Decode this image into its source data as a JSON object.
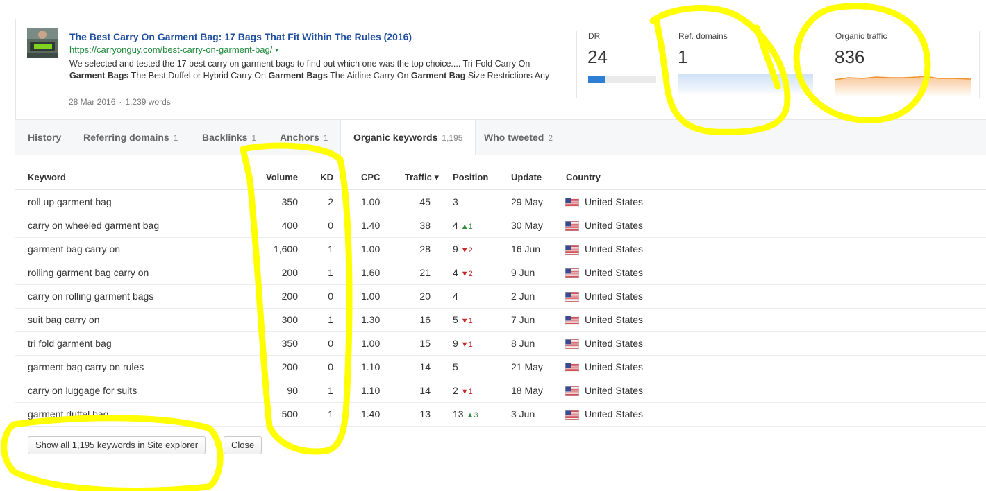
{
  "article": {
    "title": "The Best Carry On Garment Bag: 17 Bags That Fit Within The Rules (2016)",
    "url": "https://carryonguy.com/best-carry-on-garment-bag/",
    "url_caret": "▾",
    "snippet_parts": [
      {
        "text": "We selected and tested the 17 best carry on garment bags to find out which one was the top choice.... Tri-Fold Carry On ",
        "bold": false
      },
      {
        "text": "Garment Bags",
        "bold": true
      },
      {
        "text": " The Best Duffel or Hybrid Carry On ",
        "bold": false
      },
      {
        "text": "Garment Bags",
        "bold": true
      },
      {
        "text": " The Airline Carry On ",
        "bold": false
      },
      {
        "text": "Garment Bag",
        "bold": true
      },
      {
        "text": " Size Restrictions Any",
        "bold": false
      }
    ],
    "date": "28 Mar 2016",
    "separator": "·",
    "words": "1,239 words"
  },
  "metrics": {
    "dr": {
      "label": "DR",
      "value": "24",
      "bar_fraction": 0.24,
      "bar_color": "#2d7fd3"
    },
    "ref_domains": {
      "label": "Ref. domains",
      "value": "1",
      "area_color": "#7eaee5"
    },
    "organic_traffic": {
      "label": "Organic traffic",
      "value": "836",
      "line_color": "#f0902a"
    }
  },
  "tabs": [
    {
      "label": "History",
      "count": ""
    },
    {
      "label": "Referring domains",
      "count": "1"
    },
    {
      "label": "Backlinks",
      "count": "1"
    },
    {
      "label": "Anchors",
      "count": "1"
    },
    {
      "label": "Organic keywords",
      "count": "1,195",
      "active": true
    },
    {
      "label": "Who tweeted",
      "count": "2"
    }
  ],
  "table": {
    "columns": [
      "Keyword",
      "Volume",
      "KD",
      "CPC",
      "Traffic ▾",
      "Position",
      "Update",
      "Country"
    ],
    "rows": [
      {
        "keyword": "roll up garment bag",
        "volume": "350",
        "kd": "2",
        "cpc": "1.00",
        "traffic": "45",
        "position": "3",
        "change": "",
        "dir": "",
        "update": "29 May",
        "country": "United States"
      },
      {
        "keyword": "carry on wheeled garment bag",
        "volume": "400",
        "kd": "0",
        "cpc": "1.40",
        "traffic": "38",
        "position": "4",
        "change": "▲1",
        "dir": "up",
        "update": "30 May",
        "country": "United States"
      },
      {
        "keyword": "garment bag carry on",
        "volume": "1,600",
        "kd": "1",
        "cpc": "1.00",
        "traffic": "28",
        "position": "9",
        "change": "▼2",
        "dir": "down",
        "update": "16 Jun",
        "country": "United States"
      },
      {
        "keyword": "rolling garment bag carry on",
        "volume": "200",
        "kd": "1",
        "cpc": "1.60",
        "traffic": "21",
        "position": "4",
        "change": "▼2",
        "dir": "down",
        "update": "9 Jun",
        "country": "United States"
      },
      {
        "keyword": "carry on rolling garment bags",
        "volume": "200",
        "kd": "0",
        "cpc": "1.00",
        "traffic": "20",
        "position": "4",
        "change": "",
        "dir": "",
        "update": "2 Jun",
        "country": "United States"
      },
      {
        "keyword": "suit bag carry on",
        "volume": "300",
        "kd": "1",
        "cpc": "1.30",
        "traffic": "16",
        "position": "5",
        "change": "▼1",
        "dir": "down",
        "update": "7 Jun",
        "country": "United States"
      },
      {
        "keyword": "tri fold garment bag",
        "volume": "350",
        "kd": "0",
        "cpc": "1.00",
        "traffic": "15",
        "position": "9",
        "change": "▼1",
        "dir": "down",
        "update": "8 Jun",
        "country": "United States"
      },
      {
        "keyword": "garment bag carry on rules",
        "volume": "200",
        "kd": "0",
        "cpc": "1.10",
        "traffic": "14",
        "position": "5",
        "change": "",
        "dir": "",
        "update": "21 May",
        "country": "United States"
      },
      {
        "keyword": "carry on luggage for suits",
        "volume": "90",
        "kd": "1",
        "cpc": "1.10",
        "traffic": "14",
        "position": "2",
        "change": "▼1",
        "dir": "down",
        "update": "18 May",
        "country": "United States"
      },
      {
        "keyword": "garment duffel bag",
        "volume": "500",
        "kd": "1",
        "cpc": "1.40",
        "traffic": "13",
        "position": "13",
        "change": "▲3",
        "dir": "up",
        "update": "3 Jun",
        "country": "United States"
      }
    ]
  },
  "buttons": {
    "show_all": "Show all 1,195 keywords in Site explorer",
    "close": "Close"
  },
  "colors": {
    "highlight": "#ffff00",
    "link_title": "#1f4e9e",
    "link_url": "#1e8a3c"
  }
}
